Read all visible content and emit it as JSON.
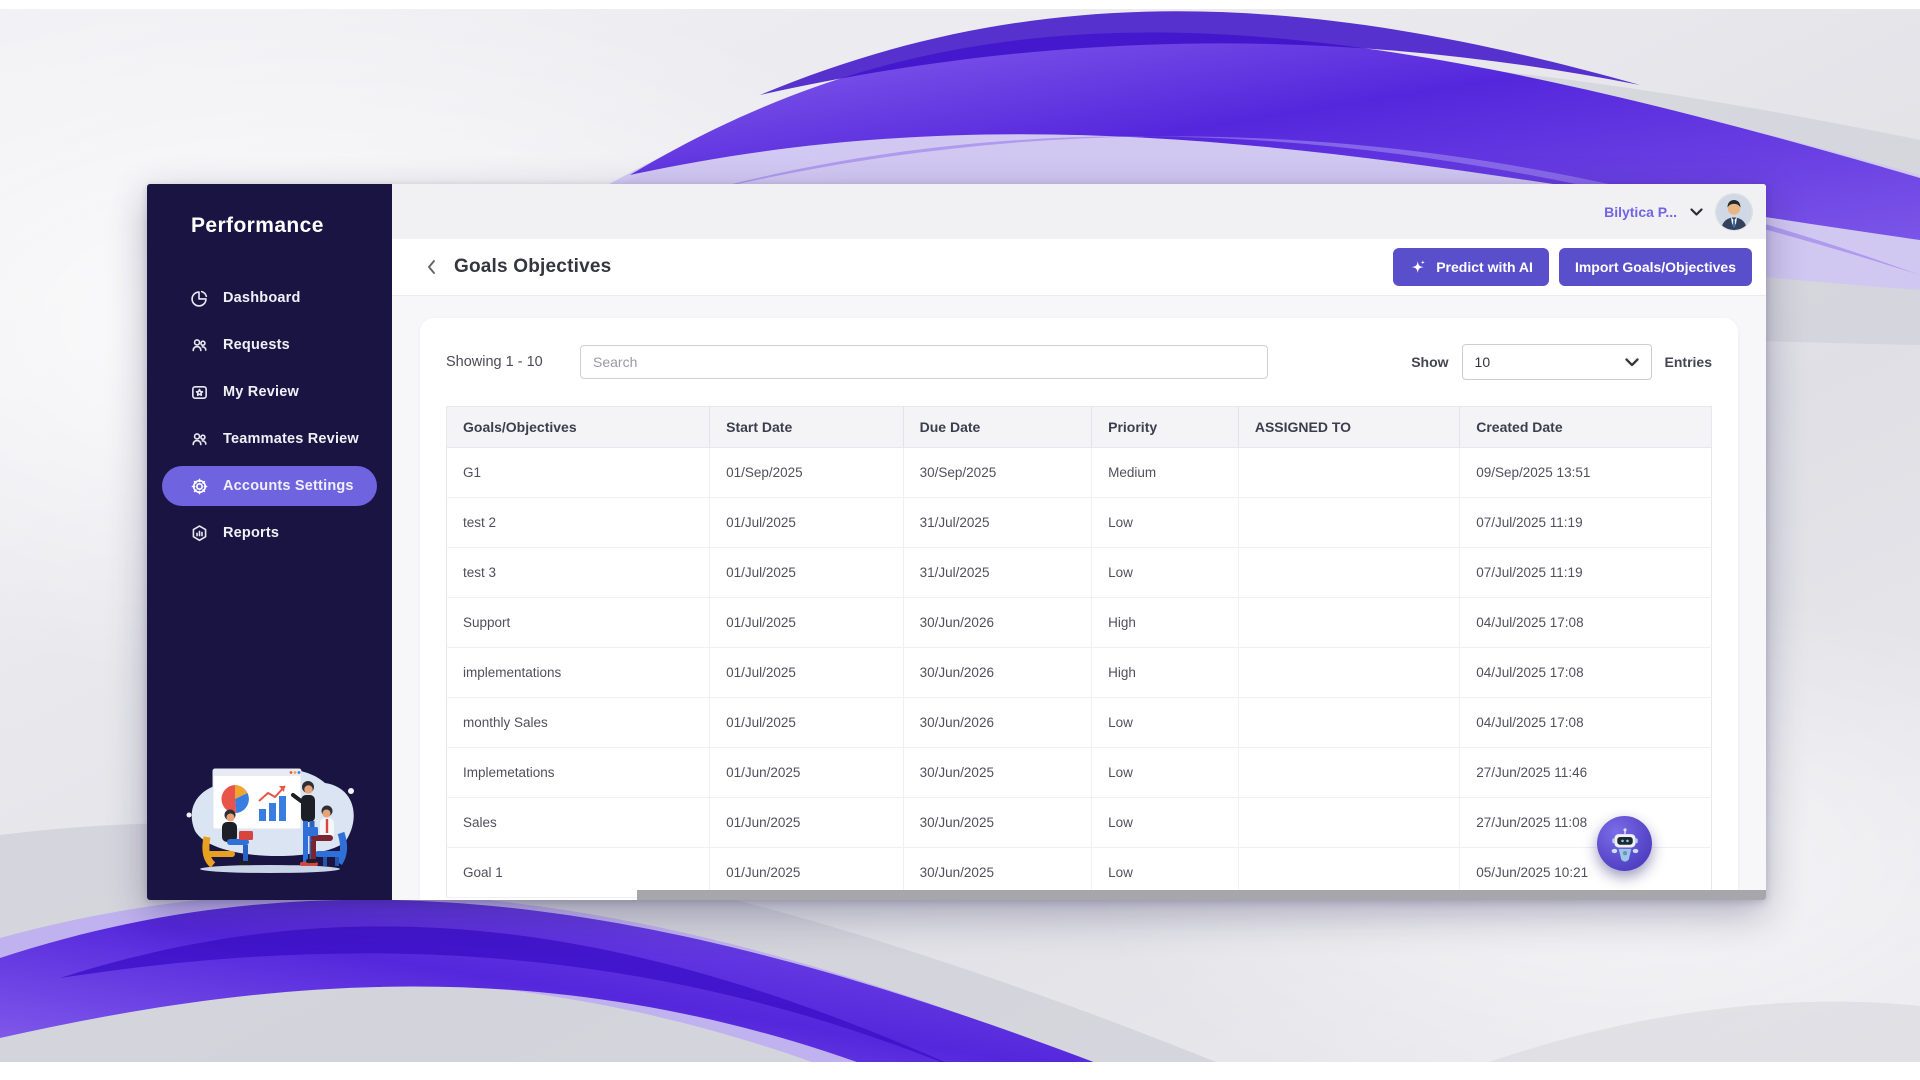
{
  "brand": "Performance",
  "sidebar": {
    "items": [
      {
        "label": "Dashboard",
        "icon": "pie-chart-icon",
        "active": false
      },
      {
        "label": "Requests",
        "icon": "people-icon",
        "active": false
      },
      {
        "label": "My Review",
        "icon": "framed-star-icon",
        "active": false
      },
      {
        "label": "Teammates Review",
        "icon": "people-icon",
        "active": false
      },
      {
        "label": "Accounts Settings",
        "icon": "gear-icon",
        "active": true
      },
      {
        "label": "Reports",
        "icon": "hexagon-chart-icon",
        "active": false
      }
    ]
  },
  "header": {
    "user_name": "Bilytica P...",
    "user_menu_icon": "chevron-down-icon",
    "avatar_icon": "user-avatar"
  },
  "page": {
    "title": "Goals Objectives",
    "back_icon": "chevron-left-icon",
    "predict_button": "Predict with AI",
    "predict_icon": "sparkle-icon",
    "import_button": "Import Goals/Objectives"
  },
  "toolbar": {
    "showing": "Showing 1 - 10",
    "search_placeholder": "Search",
    "search_value": "",
    "show_label": "Show",
    "entries_value": "10",
    "entries_label": "Entries"
  },
  "table": {
    "columns": [
      "Goals/Objectives",
      "Start Date",
      "Due Date",
      "Priority",
      "ASSIGNED TO",
      "Created Date"
    ],
    "rows": [
      {
        "goal": "G1",
        "start_date": "01/Sep/2025",
        "due_date": "30/Sep/2025",
        "priority": "Medium",
        "assigned_to": "",
        "created_date": "09/Sep/2025 13:51"
      },
      {
        "goal": "test 2",
        "start_date": "01/Jul/2025",
        "due_date": "31/Jul/2025",
        "priority": "Low",
        "assigned_to": "",
        "created_date": "07/Jul/2025 11:19"
      },
      {
        "goal": "test 3",
        "start_date": "01/Jul/2025",
        "due_date": "31/Jul/2025",
        "priority": "Low",
        "assigned_to": "",
        "created_date": "07/Jul/2025 11:19"
      },
      {
        "goal": "Support",
        "start_date": "01/Jul/2025",
        "due_date": "30/Jun/2026",
        "priority": "High",
        "assigned_to": "",
        "created_date": "04/Jul/2025 17:08"
      },
      {
        "goal": "implementations",
        "start_date": "01/Jul/2025",
        "due_date": "30/Jun/2026",
        "priority": "High",
        "assigned_to": "",
        "created_date": "04/Jul/2025 17:08"
      },
      {
        "goal": "monthly Sales",
        "start_date": "01/Jul/2025",
        "due_date": "30/Jun/2026",
        "priority": "Low",
        "assigned_to": "",
        "created_date": "04/Jul/2025 17:08"
      },
      {
        "goal": "Implemetations",
        "start_date": "01/Jun/2025",
        "due_date": "30/Jun/2025",
        "priority": "Low",
        "assigned_to": "",
        "created_date": "27/Jun/2025 11:46"
      },
      {
        "goal": "Sales",
        "start_date": "01/Jun/2025",
        "due_date": "30/Jun/2025",
        "priority": "Low",
        "assigned_to": "",
        "created_date": "27/Jun/2025 11:08"
      },
      {
        "goal": "Goal 1",
        "start_date": "01/Jun/2025",
        "due_date": "30/Jun/2025",
        "priority": "Low",
        "assigned_to": "",
        "created_date": "05/Jun/2025 10:21"
      }
    ]
  },
  "chat": {
    "icon": "robot-icon"
  },
  "colors": {
    "sidebar_bg": "#1a1442",
    "accent": "#6f63e0",
    "button": "#5a4fcb",
    "username": "#7165e3",
    "ribbon_deep": "#3c10c8",
    "ribbon_mid": "#5a2ee0",
    "ribbon_light": "#b9a9f2"
  }
}
